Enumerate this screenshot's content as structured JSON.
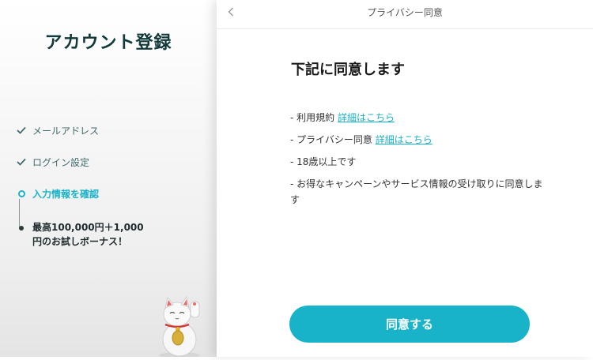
{
  "sidebar": {
    "title": "アカウント登録",
    "steps": [
      {
        "label": "メールアドレス",
        "state": "done"
      },
      {
        "label": "ログイン設定",
        "state": "done"
      },
      {
        "label": "入力情報を確認",
        "state": "current"
      },
      {
        "label": "最高100,000円＋1,000円のお試しボーナス！",
        "state": "pending"
      }
    ]
  },
  "header": {
    "title": "プライバシー同意",
    "back_icon": "chevron-left-icon"
  },
  "main": {
    "heading": "下記に同意します",
    "terms": [
      {
        "prefix": "- 利用規約 ",
        "link": "詳細はこちら"
      },
      {
        "prefix": "- プライバシー同意 ",
        "link": "詳細はこちら"
      },
      {
        "prefix": "- 18歳以上です"
      },
      {
        "prefix": "- お得なキャンペーンやサービス情報の受け取りに同意します"
      }
    ],
    "agree_button": "同意する"
  },
  "colors": {
    "accent": "#19b3c9",
    "title_dark": "#133a3a",
    "step_done": "#3f6a6c"
  },
  "decoration": {
    "mascot": "maneki-neko-cat-image"
  }
}
